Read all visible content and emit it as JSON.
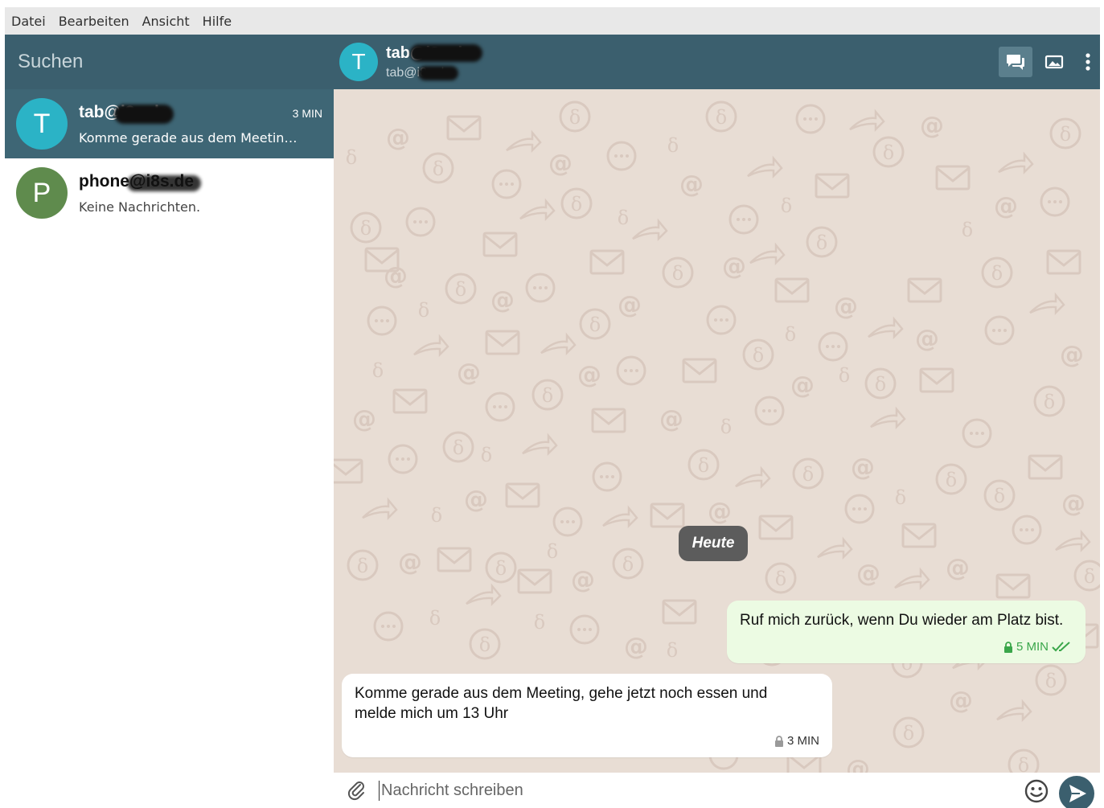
{
  "menubar": {
    "items": [
      {
        "label": "Datei"
      },
      {
        "label": "Bearbeiten"
      },
      {
        "label": "Ansicht"
      },
      {
        "label": "Hilfe"
      }
    ]
  },
  "sidebar": {
    "search_placeholder": "Suchen",
    "conversations": [
      {
        "initial": "T",
        "name": "tab@i8s.de",
        "preview": "Komme gerade aus dem Meeting,...",
        "time": "3 MIN",
        "avatar_color": "#2bb3c6",
        "active": true
      },
      {
        "initial": "P",
        "name": "phone@i8s.de",
        "preview": "Keine Nachrichten.",
        "time": "",
        "avatar_color": "#5f8b4d",
        "active": false
      }
    ]
  },
  "chat": {
    "header": {
      "initial": "T",
      "name": "tab@i8s.de",
      "subtitle": "tab@i8s.de",
      "avatar_color": "#2bb3c6"
    },
    "actions": [
      {
        "icon": "chat-bubbles-icon",
        "active": true
      },
      {
        "icon": "image-icon",
        "active": false
      },
      {
        "icon": "more-vertical-icon",
        "active": false
      }
    ],
    "date_chip": "Heute",
    "messages": [
      {
        "direction": "out",
        "text": "Ruf mich zurück, wenn Du wieder am Platz bist.",
        "time": "5 MIN",
        "status": "read-double-check",
        "encrypted": true
      },
      {
        "direction": "in",
        "text": "Komme gerade aus dem Meeting, gehe jetzt noch essen und melde mich um 13 Uhr",
        "time": "3 MIN",
        "encrypted": true
      }
    ],
    "composer": {
      "placeholder": "Nachricht schreiben"
    }
  },
  "colors": {
    "header": "#3b5f6e",
    "active_item": "#3e6675",
    "chat_background": "#e8ddd4",
    "outgoing_bubble": "#ecfbe3",
    "incoming_bubble": "#ffffff",
    "send_button": "#3b5f6e"
  }
}
